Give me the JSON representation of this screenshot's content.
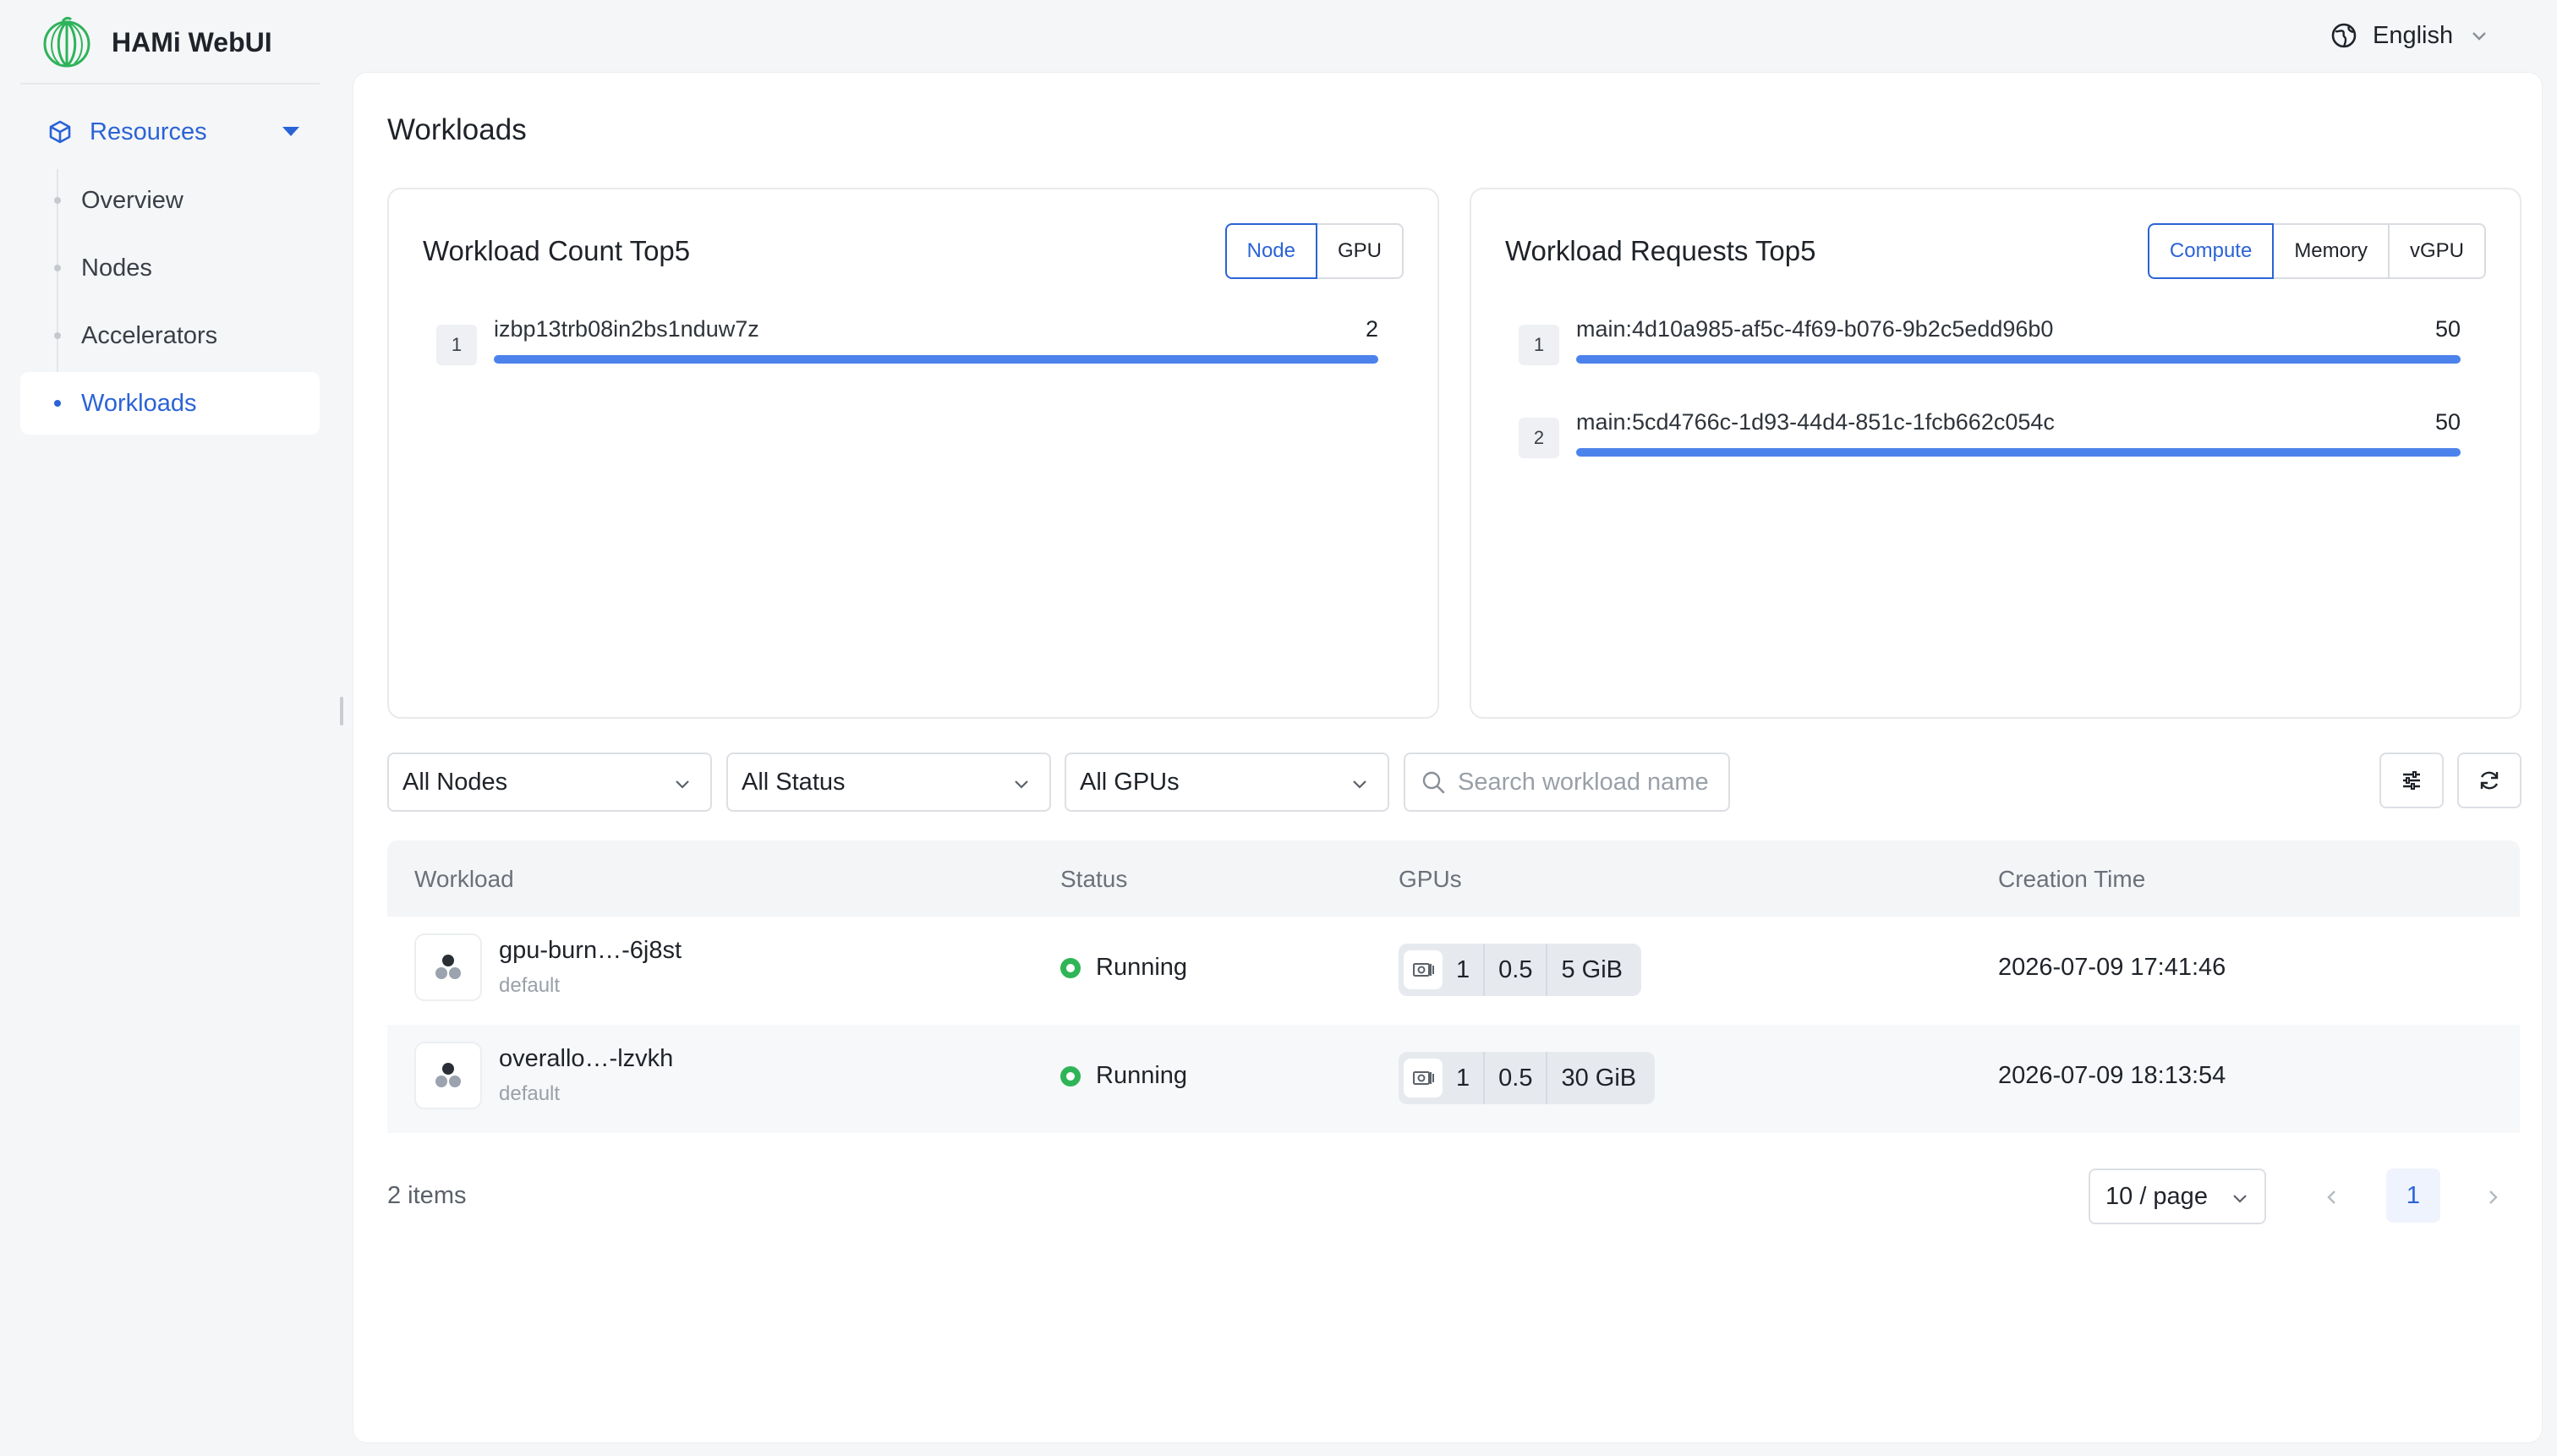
{
  "app": {
    "title": "HAMi WebUI",
    "logo_icon": "hami-melon-logo-icon"
  },
  "header": {
    "language": "English",
    "language_icon": "globe-icon"
  },
  "sidebar": {
    "group": {
      "label": "Resources",
      "icon": "cube-icon"
    },
    "items": [
      {
        "label": "Overview",
        "active": false
      },
      {
        "label": "Nodes",
        "active": false
      },
      {
        "label": "Accelerators",
        "active": false
      },
      {
        "label": "Workloads",
        "active": true
      }
    ]
  },
  "page": {
    "title": "Workloads"
  },
  "count_card": {
    "title": "Workload Count Top5",
    "tabs": [
      {
        "label": "Node",
        "active": true
      },
      {
        "label": "GPU",
        "active": false
      }
    ],
    "rows": [
      {
        "rank": "1",
        "name": "izbp13trb08in2bs1nduw7z",
        "value": "2",
        "fill": 1.0
      }
    ]
  },
  "requests_card": {
    "title": "Workload Requests Top5",
    "tabs": [
      {
        "label": "Compute",
        "active": true
      },
      {
        "label": "Memory",
        "active": false
      },
      {
        "label": "vGPU",
        "active": false
      }
    ],
    "rows": [
      {
        "rank": "1",
        "name": "main:4d10a985-af5c-4f69-b076-9b2c5edd96b0",
        "value": "50",
        "fill": 1.0
      },
      {
        "rank": "2",
        "name": "main:5cd4766c-1d93-44d4-851c-1fcb662c054c",
        "value": "50",
        "fill": 1.0
      }
    ]
  },
  "filters": {
    "nodes": "All Nodes",
    "status": "All Status",
    "gpus": "All GPUs",
    "search_placeholder": "Search workload name"
  },
  "table": {
    "columns": {
      "workload": "Workload",
      "status": "Status",
      "gpus": "GPUs",
      "created": "Creation Time"
    },
    "rows": [
      {
        "name": "gpu-burn…-6j8st",
        "namespace": "default",
        "status": "Running",
        "gpu_count": "1",
        "gpu_share": "0.5",
        "gpu_mem": "5 GiB",
        "created": "2026-07-09 17:41:46"
      },
      {
        "name": "overallo…-lzvkh",
        "namespace": "default",
        "status": "Running",
        "gpu_count": "1",
        "gpu_share": "0.5",
        "gpu_mem": "30 GiB",
        "created": "2026-07-09 18:13:54"
      }
    ]
  },
  "pagination": {
    "total": "2 items",
    "page_size": "10 / page",
    "current_page": "1"
  },
  "colors": {
    "accent": "#2b63d6",
    "bar": "#4c82eb",
    "running": "#2fb558",
    "brand_logo": "#2eb35a"
  }
}
